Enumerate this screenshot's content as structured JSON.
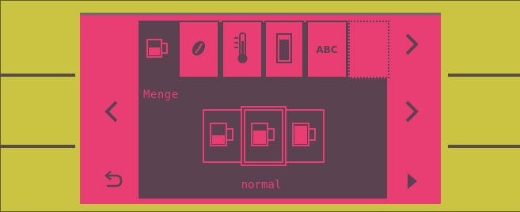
{
  "quantity_label": "Menge",
  "selected_quantity": "normal",
  "tabs": [
    {
      "id": "quantity",
      "icon": "cup-icon",
      "active": true
    },
    {
      "id": "bean",
      "icon": "coffee-bean-icon",
      "active": false
    },
    {
      "id": "temperature",
      "icon": "thermometer-icon",
      "active": false
    },
    {
      "id": "milk",
      "icon": "container-icon",
      "active": false
    },
    {
      "id": "name",
      "icon": "abc-text-icon",
      "text": "ABC",
      "active": false
    },
    {
      "id": "empty",
      "icon": "empty-slot",
      "active": false
    }
  ],
  "quantity_options": [
    {
      "level": "small",
      "icon": "cup-small-icon",
      "selected": false
    },
    {
      "level": "normal",
      "icon": "cup-normal-icon",
      "selected": true
    },
    {
      "level": "large",
      "icon": "cup-large-icon",
      "selected": false
    }
  ],
  "colors": {
    "background": "#c9c543",
    "screen": "#e83e73",
    "panel": "#5b4250"
  }
}
